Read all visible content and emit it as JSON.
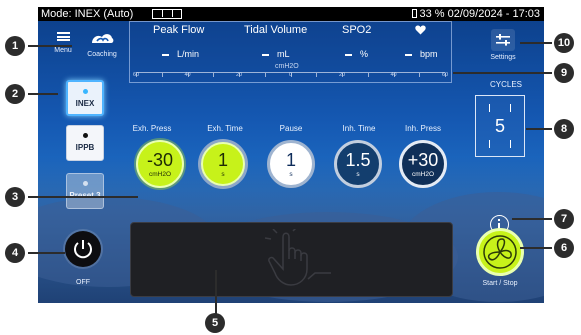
{
  "status_bar": {
    "mode": "Mode: INEX (Auto)",
    "battery_and_datetime": "33 % 02/09/2024 - 17:03"
  },
  "top_left": {
    "menu_label": "Menu",
    "coaching_label": "Coaching"
  },
  "monitor": {
    "labels": [
      "Peak Flow",
      "Tidal Volume",
      "SPO2"
    ],
    "units": [
      "L/min",
      "mL",
      "%",
      "bpm"
    ],
    "scale_label": "cmH2O",
    "scale_ticks": [
      "60",
      "50",
      "40",
      "30",
      "20",
      "10",
      "0",
      "10",
      "20",
      "30",
      "40",
      "50",
      "60"
    ]
  },
  "settings": {
    "label": "Settings"
  },
  "modes": {
    "inex": "INEX",
    "ippb": "IPPB",
    "preset3": "Preset 3"
  },
  "parameters": [
    {
      "label": "Exh. Press",
      "value": "-30",
      "unit": "cmH2O"
    },
    {
      "label": "Exh. Time",
      "value": "1",
      "unit": "s"
    },
    {
      "label": "Pause",
      "value": "1",
      "unit": "s"
    },
    {
      "label": "Inh. Time",
      "value": "1.5",
      "unit": "s"
    },
    {
      "label": "Inh. Press",
      "value": "+30",
      "unit": "cmH2O"
    }
  ],
  "cycles": {
    "label": "CYCLES",
    "value": "5"
  },
  "power": {
    "label": "OFF"
  },
  "start_stop": {
    "label": "Start / Stop"
  },
  "callouts": [
    "1",
    "2",
    "3",
    "4",
    "5",
    "6",
    "7",
    "8",
    "9",
    "10"
  ],
  "colors": {
    "accent_green": "#c7f21a",
    "screen_blue": "#1558b2",
    "mode_selected": "#4fb4ff"
  }
}
